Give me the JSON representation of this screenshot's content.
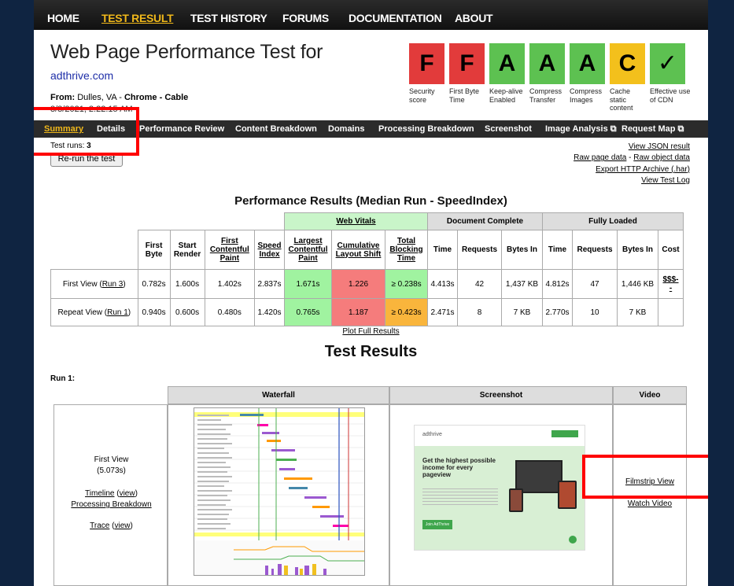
{
  "topnav": [
    {
      "label": "HOME",
      "active": false
    },
    {
      "label": "TEST RESULT",
      "active": true
    },
    {
      "label": "TEST HISTORY",
      "active": false
    },
    {
      "label": "FORUMS",
      "active": false
    },
    {
      "label": "DOCUMENTATION",
      "active": false
    },
    {
      "label": "ABOUT",
      "active": false
    }
  ],
  "header": {
    "title": "Web Page Performance Test for",
    "site": "adthrive.com",
    "from_label": "From:",
    "from_location": "Dulles, VA -",
    "from_browser": "Chrome",
    "from_sep": "-",
    "from_conn": "Cable",
    "date": "3/3/2021, 2:22:15 AM"
  },
  "grades": [
    {
      "letter": "F",
      "label": "Security score",
      "color": "#e23b3b"
    },
    {
      "letter": "F",
      "label": "First Byte Time",
      "color": "#e23b3b"
    },
    {
      "letter": "A",
      "label": "Keep-alive Enabled",
      "color": "#5dc151"
    },
    {
      "letter": "A",
      "label": "Compress Transfer",
      "color": "#5dc151"
    },
    {
      "letter": "A",
      "label": "Compress Images",
      "color": "#5dc151"
    },
    {
      "letter": "C",
      "label": "Cache static content",
      "color": "#f3c01c"
    },
    {
      "letter": "✓",
      "label": "Effective use of CDN",
      "color": "#5dc151"
    }
  ],
  "subnav": [
    {
      "label": "Summary",
      "active": true
    },
    {
      "label": "Details",
      "active": false
    },
    {
      "label": "Performance Review",
      "active": false
    },
    {
      "label": "Content Breakdown",
      "active": false
    },
    {
      "label": "Domains",
      "active": false
    },
    {
      "label": "Processing Breakdown",
      "active": false
    },
    {
      "label": "Screenshot",
      "active": false
    },
    {
      "label": "Image Analysis ⧉",
      "active": false
    },
    {
      "label": "Request Map ⧉",
      "active": false
    }
  ],
  "summary": {
    "test_runs_label": "Test runs:",
    "test_runs": "3",
    "rerun_button": "Re-run the test",
    "links": {
      "view_json": "View JSON result",
      "raw_page": "Raw page data",
      "dash": "-",
      "raw_object": "Raw object data",
      "export_har": "Export HTTP Archive (.har)",
      "view_log": "View Test Log"
    }
  },
  "perf": {
    "title": "Performance Results (Median Run - SpeedIndex)",
    "groups": {
      "web_vitals": "Web Vitals",
      "doc_complete": "Document Complete",
      "fully_loaded": "Fully Loaded"
    },
    "headers": {
      "first_byte": "First Byte",
      "start_render": "Start Render",
      "fcp": "First Contentful Paint",
      "speed_index": "Speed Index",
      "lcp": "Largest Contentful Paint",
      "cls": "Cumulative Layout Shift",
      "tbt": "Total Blocking Time",
      "time": "Time",
      "requests": "Requests",
      "bytes_in": "Bytes In",
      "cost": "Cost"
    },
    "rows": [
      {
        "label": "First View (",
        "run": "Run 3",
        "label_end": ")",
        "first_byte": "0.782s",
        "start_render": "1.600s",
        "fcp": "1.402s",
        "speed_index": "2.837s",
        "lcp": "1.671s",
        "cls": "1.226",
        "tbt": "≥ 0.238s",
        "dc_time": "4.413s",
        "dc_requests": "42",
        "dc_bytes": "1,437 KB",
        "fl_time": "4.812s",
        "fl_requests": "47",
        "fl_bytes": "1,446 KB",
        "cost": "$$$-\n-"
      },
      {
        "label": "Repeat View (",
        "run": "Run 1",
        "label_end": ")",
        "first_byte": "0.940s",
        "start_render": "0.600s",
        "fcp": "0.480s",
        "speed_index": "1.420s",
        "lcp": "0.765s",
        "cls": "1.187",
        "tbt": "≥ 0.423s",
        "dc_time": "2.471s",
        "dc_requests": "8",
        "dc_bytes": "7 KB",
        "fl_time": "2.770s",
        "fl_requests": "10",
        "fl_bytes": "7 KB",
        "cost": ""
      }
    ],
    "plot_full": "Plot Full Results"
  },
  "results": {
    "title": "Test Results",
    "run_label": "Run 1:",
    "columns": {
      "waterfall": "Waterfall",
      "screenshot": "Screenshot",
      "video": "Video"
    },
    "first_view": {
      "label": "First View",
      "time": "(5.073s)",
      "timeline": "Timeline",
      "view": "view",
      "processing": "Processing Breakdown",
      "trace": "Trace"
    },
    "video": {
      "filmstrip": "Filmstrip View",
      "watch": "Watch Video"
    },
    "screenshot_text": {
      "logo": "adthrive",
      "headline": "Get the highest possible income for every pageview",
      "button": "Join AdThrive"
    }
  },
  "colors": {
    "accent": "#f0b81a",
    "highlight": "#ff0000",
    "link": "#1e2ea8"
  }
}
